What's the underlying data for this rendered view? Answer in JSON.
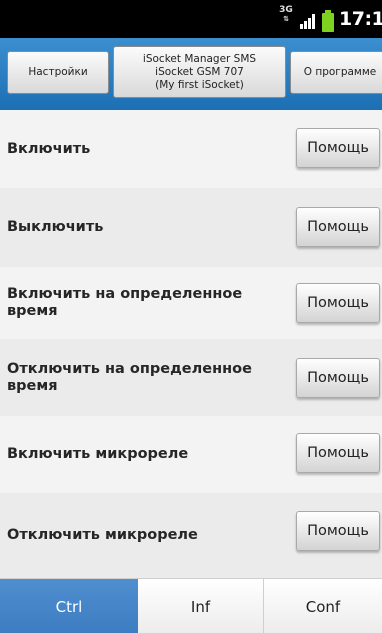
{
  "status_bar": {
    "network": "3G",
    "time": "17:13",
    "icons": [
      "network-3g-icon",
      "signal-icon",
      "battery-icon"
    ],
    "battery_color": "#7ed321"
  },
  "header": {
    "settings_label": "Настройки",
    "device_lines": [
      "iSocket Manager SMS",
      "iSocket GSM 707",
      "(My first iSocket)"
    ],
    "about_label": "О программе",
    "accent_color": "#2a7fc4"
  },
  "commands": [
    {
      "label": "Включить",
      "help": "Помощь"
    },
    {
      "label": "Выключить",
      "help": "Помощь"
    },
    {
      "label": "Включить на определенное время",
      "help": "Помощь"
    },
    {
      "label": "Отключить на определенное время",
      "help": "Помощь"
    },
    {
      "label": "Включить микрореле",
      "help": "Помощь"
    },
    {
      "label": "Отключить микрореле",
      "help": "Помощь"
    }
  ],
  "tabs": [
    {
      "label": "Ctrl",
      "selected": true
    },
    {
      "label": "Inf",
      "selected": false
    },
    {
      "label": "Conf",
      "selected": false
    }
  ]
}
